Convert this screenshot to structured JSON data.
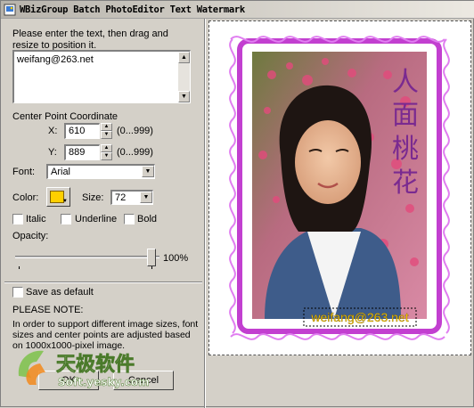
{
  "window": {
    "title": "WBizGroup Batch PhotoEditor Text Watermark"
  },
  "instructions": "Please enter the text, then drag and resize to position it.",
  "text_input": {
    "value": "weifang@263.net"
  },
  "center_point": {
    "label": "Center Point Coordinate",
    "x_label": "X:",
    "x_value": "610",
    "x_range": "(0...999)",
    "y_label": "Y:",
    "y_value": "889",
    "y_range": "(0...999)"
  },
  "font": {
    "label": "Font:",
    "value": "Arial"
  },
  "color": {
    "label": "Color:",
    "swatch": "#ffd000"
  },
  "size": {
    "label": "Size:",
    "value": "72"
  },
  "style": {
    "italic": "Italic",
    "underline": "Underline",
    "bold": "Bold"
  },
  "opacity": {
    "label": "Opacity:",
    "value_label": "100%",
    "level_percent": 100
  },
  "save_default": "Save as default",
  "note": {
    "title": "PLEASE NOTE:",
    "body": "In order to support different image sizes, font sizes and center points are adjusted based on 1000x1000-pixel image."
  },
  "buttons": {
    "ok": "OK",
    "cancel": "Cancel"
  },
  "preview": {
    "overlay_text": "weifang@263.net",
    "calligraphy": "人面桃花",
    "overlay_color": "#ffd000",
    "frame_color": "#c23fd0"
  },
  "logo": {
    "text_cn": "天极软件",
    "text_url": "Soft.yesky.com"
  }
}
